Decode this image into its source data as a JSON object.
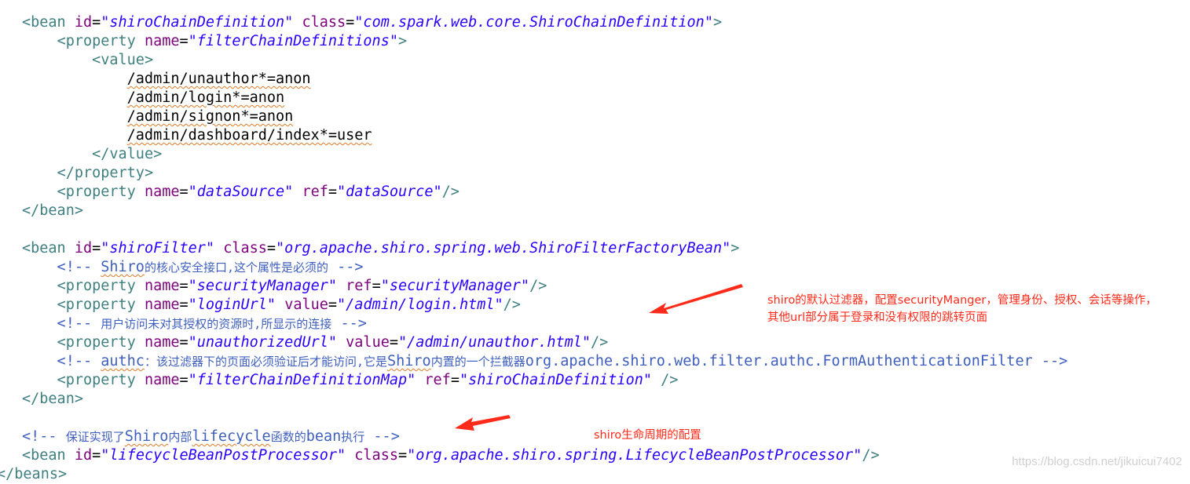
{
  "code": {
    "l1": {
      "tag": "bean",
      "a1": "id",
      "v1": "\"shiroChainDefinition\"",
      "a2": "class",
      "v2": "\"com.spark.web.core.ShiroChainDefinition\""
    },
    "l2": {
      "tag": "property",
      "a1": "name",
      "v1": "\"filterChainDefinitions\""
    },
    "l3": {
      "tag": "value"
    },
    "l4": {
      "text": "/admin/unauthor*=anon"
    },
    "l5": {
      "text": "/admin/login*=anon"
    },
    "l6": {
      "text": "/admin/signon*=anon"
    },
    "l7": {
      "text": "/admin/dashboard/index*=user"
    },
    "l8": {
      "tag": "value"
    },
    "l9": {
      "tag": "property"
    },
    "l10": {
      "tag": "property",
      "a1": "name",
      "v1": "\"dataSource\"",
      "a2": "ref",
      "v2": "\"dataSource\""
    },
    "l11": {
      "tag": "bean"
    },
    "l13": {
      "tag": "bean",
      "a1": "id",
      "v1": "\"shiroFilter\"",
      "a2": "class",
      "v2": "\"org.apache.shiro.spring.web.ShiroFilterFactoryBean\""
    },
    "l14": {
      "c1": "Shiro",
      "c2": "的核心安全接口",
      "c3": ",这个属性是必须的"
    },
    "l15": {
      "tag": "property",
      "a1": "name",
      "v1": "\"securityManager\"",
      "a2": "ref",
      "v2": "\"securityManager\""
    },
    "l16": {
      "tag": "property",
      "a1": "name",
      "v1": "\"loginUrl\"",
      "a2": "value",
      "v2": "\"/admin/login.html\""
    },
    "l17": {
      "c1": "用户访问未对其授权的资源时",
      "c2": ",所显示的连接"
    },
    "l18": {
      "tag": "property",
      "a1": "name",
      "v1": "\"unauthorizedUrl\"",
      "a2": "value",
      "v2": "\"/admin/unauthor.html\""
    },
    "l19": {
      "c1": "authc",
      "c2": "：该过滤器下的页面必须验证后才能访问",
      "c3": ",它是",
      "c4": "Shiro",
      "c5": "内置的一个拦截器",
      "c6": "org.apache.shiro.web.filter.authc.FormAuthenticationFilter"
    },
    "l20": {
      "tag": "property",
      "a1": "name",
      "v1": "\"filterChainDefinitionMap\"",
      "a2": "ref",
      "v2": "\"shiroChainDefinition\""
    },
    "l21": {
      "tag": "bean"
    },
    "l23": {
      "c1": "保证实现了",
      "c2": "Shiro",
      "c3": "内部",
      "c4": "lifecycle",
      "c5": "函数的",
      "c6": "bean",
      "c7": "执行"
    },
    "l24": {
      "tag": "bean",
      "a1": "id",
      "v1": "\"lifecycleBeanPostProcessor\"",
      "a2": "class",
      "v2": "\"org.apache.shiro.spring.LifecycleBeanPostProcessor\""
    },
    "l25": {
      "tag": "beans"
    }
  },
  "annotations": {
    "filter_note_line1": "shiro的默认过滤器，配置securityManger，管理身份、授权、会话等操作，",
    "filter_note_line2": "其他url部分属于登录和没有权限的跳转页面",
    "lifecycle_note": "shiro生命周期的配置"
  },
  "watermark": "https://blog.csdn.net/jikuicui7402",
  "colors": {
    "tag": "#3f7f7f",
    "attribute": "#7f007f",
    "value": "#2a00ff",
    "comment": "#3f5fbf",
    "annotation": "#ff2a1a"
  }
}
